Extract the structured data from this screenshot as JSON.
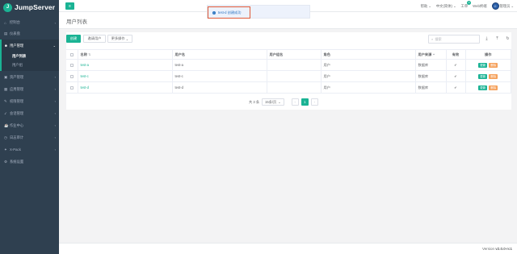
{
  "app": {
    "logo_mark": "J",
    "logo_text": "JumpServer"
  },
  "sidebar": {
    "items": [
      {
        "label": "仪表盘",
        "icon": "speedometer-icon",
        "glyph": "▤",
        "active": false,
        "chevron": false
      },
      {
        "label": "用户管理",
        "icon": "users-icon",
        "glyph": "☻",
        "active": true,
        "chevron": true
      },
      {
        "label": "资产管理",
        "icon": "inbox-icon",
        "glyph": "▣",
        "active": false,
        "chevron": true
      },
      {
        "label": "应用管理",
        "icon": "th-icon",
        "glyph": "▦",
        "active": false,
        "chevron": true
      },
      {
        "label": "权限管理",
        "icon": "edit-icon",
        "glyph": "✎",
        "active": false,
        "chevron": true
      },
      {
        "label": "会话管理",
        "icon": "rocket-icon",
        "glyph": "➶",
        "active": false,
        "chevron": true
      },
      {
        "label": "作业中心",
        "icon": "coffee-icon",
        "glyph": "☕",
        "active": false,
        "chevron": true
      },
      {
        "label": "日志审计",
        "icon": "history-icon",
        "glyph": "◷",
        "active": false,
        "chevron": true
      },
      {
        "label": "X-Pack",
        "icon": "sitemap-icon",
        "glyph": "✦",
        "active": false,
        "chevron": true
      },
      {
        "label": "系统设置",
        "icon": "gear-icon",
        "glyph": "⚙",
        "active": false,
        "chevron": false
      }
    ],
    "dashboard_partial": "控制台",
    "subitems": [
      {
        "label": "用户列表",
        "current": true
      },
      {
        "label": "用户组",
        "current": false
      }
    ]
  },
  "topbar": {
    "menu_icon": "≡",
    "help": "帮助",
    "language": "中文(简体)",
    "ticket": "工单",
    "ticket_badge": "0",
    "web_terminal": "Web终端",
    "username": "管理员"
  },
  "toast": {
    "message": "test-d 创建成功"
  },
  "page": {
    "title": "用户列表"
  },
  "toolbar": {
    "create": "创建",
    "invite": "邀请用户",
    "more": "更多操作",
    "search_placeholder": "搜索"
  },
  "table": {
    "headers": [
      "",
      "名称",
      "用户名",
      "用户组名",
      "角色",
      "用户来源",
      "有效",
      "操作"
    ],
    "rows": [
      {
        "name": "test-a",
        "username": "test-a",
        "group": "",
        "role": "用户",
        "source": "数据库",
        "valid": "✔"
      },
      {
        "name": "test-c",
        "username": "test-c",
        "group": "",
        "role": "用户",
        "source": "数据库",
        "valid": "✔"
      },
      {
        "name": "test-d",
        "username": "test-d",
        "group": "",
        "role": "用户",
        "source": "数据库",
        "valid": "✔"
      }
    ],
    "op_update": "更新",
    "op_delete": "删除"
  },
  "pager": {
    "total": "共 3 条",
    "page_size": "15条/页",
    "prev": "‹",
    "current": "1",
    "next": "›"
  },
  "footer": {
    "version_label": "Version",
    "version": "v2.0.0-rc1"
  },
  "colors": {
    "accent": "#1ab394",
    "sidebar": "#2f4050",
    "toast_border": "#e05a38"
  }
}
